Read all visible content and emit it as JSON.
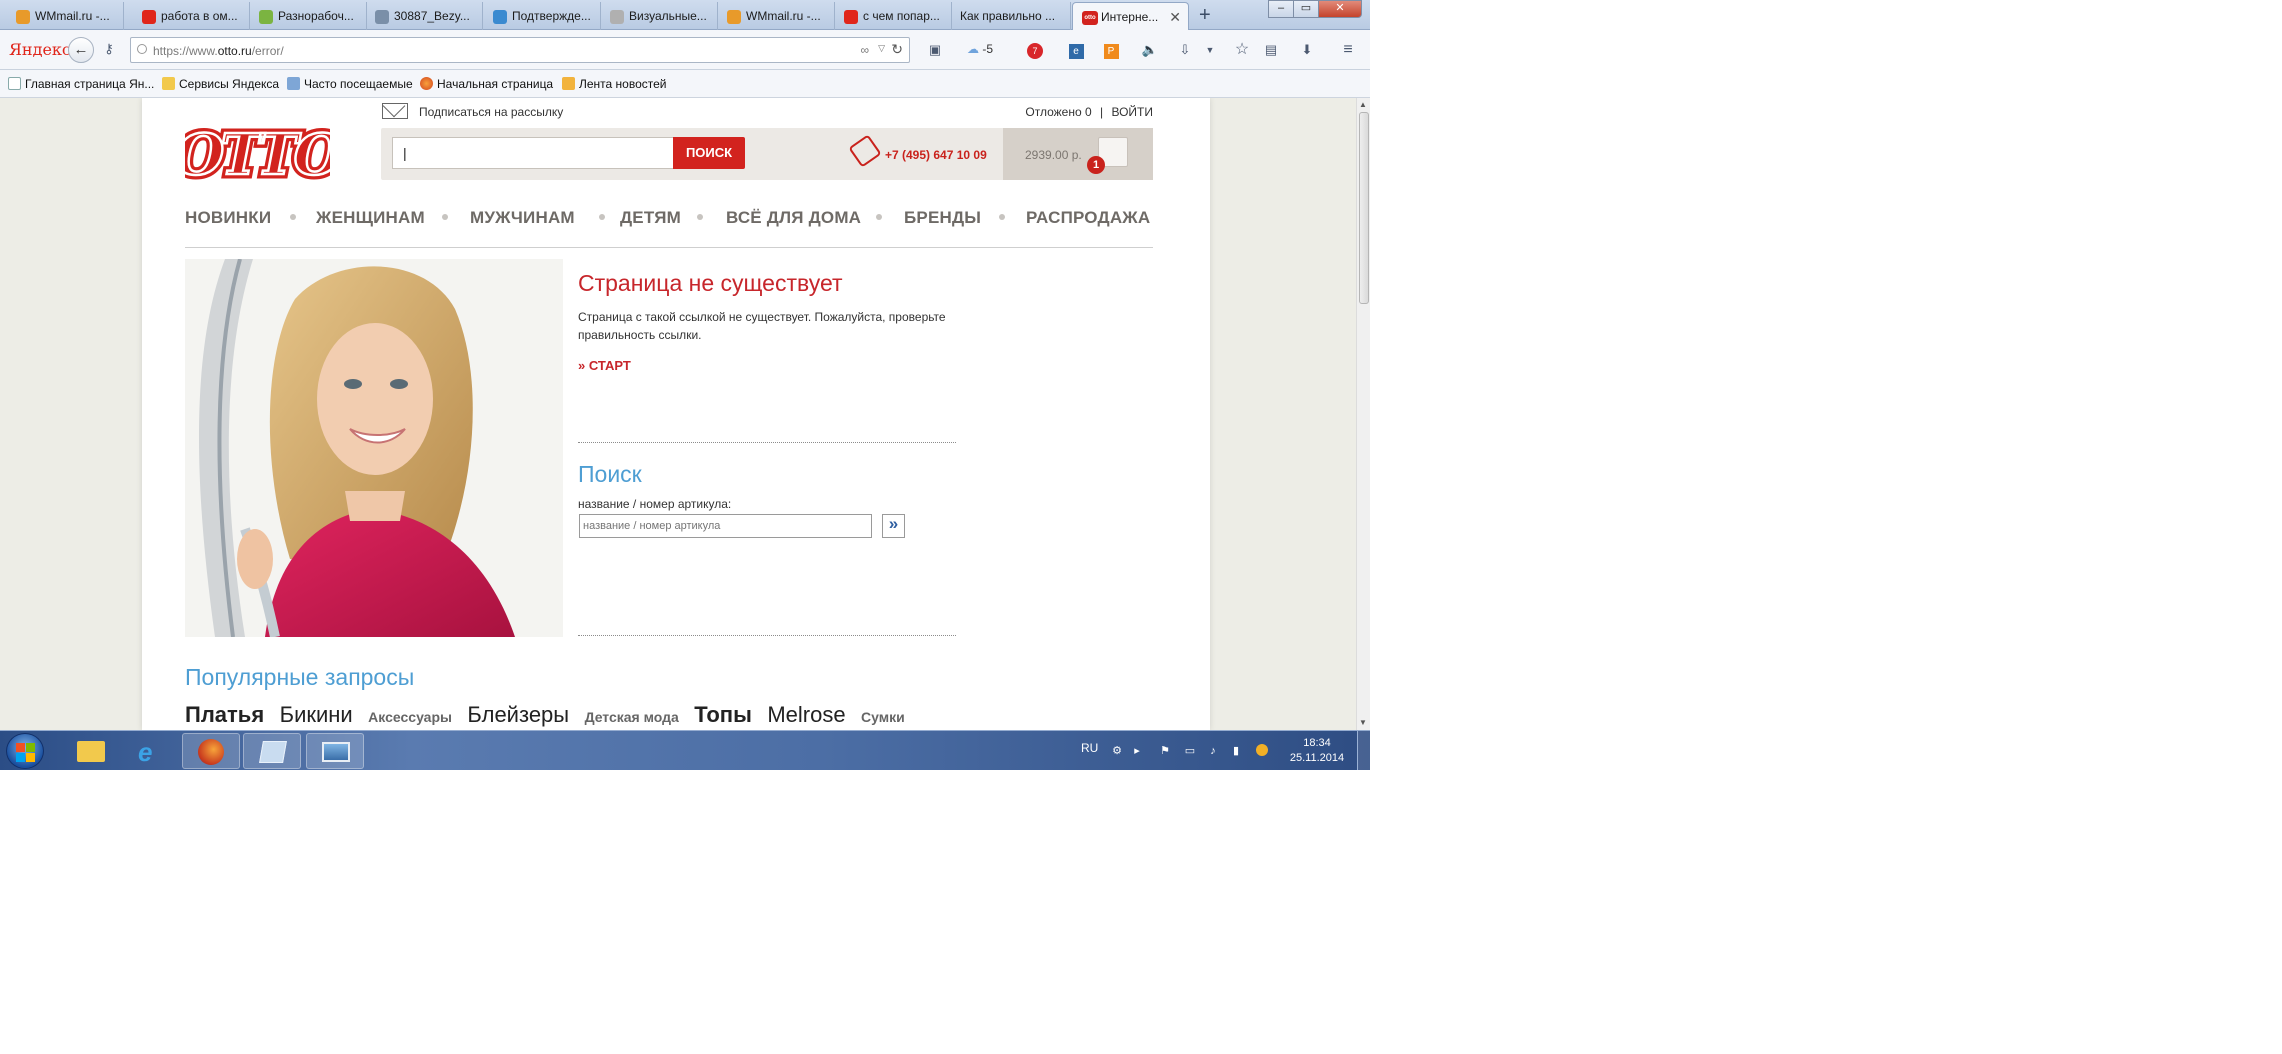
{
  "browser": {
    "tabs": [
      {
        "label": "WMmail.ru -...",
        "icon": "wmmail-icon",
        "color": "#e89a2a"
      },
      {
        "label": "работа в ом...",
        "icon": "yandex-icon",
        "color": "#e0261b"
      },
      {
        "label": "Разнорабоч...",
        "icon": "green-icon",
        "color": "#7bb441"
      },
      {
        "label": "30887_Bezy...",
        "icon": "image-icon",
        "color": "#7a8fa8"
      },
      {
        "label": "Подтвержде...",
        "icon": "globe-icon",
        "color": "#3a8ad0"
      },
      {
        "label": "Визуальные...",
        "icon": "page-icon",
        "color": "#b0b0b0"
      },
      {
        "label": "WMmail.ru -...",
        "icon": "wmmail-icon",
        "color": "#e89a2a"
      },
      {
        "label": "с чем попар...",
        "icon": "yandex-icon",
        "color": "#e0261b"
      },
      {
        "label": "Как правильно ...",
        "icon": "",
        "color": ""
      },
      {
        "label": "Интерне...",
        "icon": "otto-icon",
        "color": "#d2231e",
        "icon_text": "otto"
      }
    ],
    "new_tab_glyph": "+",
    "close_glyph": "✕",
    "yandex_label": "Яндекс",
    "url_prefix": "https://www.",
    "url_domain": "otto.ru",
    "url_path": "/error/",
    "weather": "-5",
    "mail_badge": "7",
    "bookmarks": [
      {
        "label": "Главная страница Ян...",
        "icon": "page-icon"
      },
      {
        "label": "Сервисы Яндекса",
        "icon": "folder-icon"
      },
      {
        "label": "Часто посещаемые",
        "icon": "star-folder-icon"
      },
      {
        "label": "Начальная страница",
        "icon": "firefox-icon"
      },
      {
        "label": "Лента новостей",
        "icon": "rss-icon"
      }
    ]
  },
  "site": {
    "newsletter": "Подписаться на рассылку",
    "deferred": "Отложено 0",
    "separator": "|",
    "login": "ВОЙТИ",
    "logo_text": "OTTO",
    "search_value": "|",
    "search_button": "ПОИСК",
    "phone": "+7 (495) 647 10 09",
    "cart_total": "2939.00 р.",
    "cart_count": "1",
    "nav": [
      "НОВИНКИ",
      "ЖЕНЩИНАМ",
      "МУЖЧИНАМ",
      "ДЕТЯМ",
      "ВСЁ ДЛЯ ДОМА",
      "БРЕНДЫ",
      "РАСПРОДАЖА"
    ],
    "error_title": "Страница не существует",
    "error_text": "Страница с такой ссылкой не существует. Пожалуйста, проверьте правильность ссылки.",
    "start_link": "» СТАРТ",
    "search_title": "Поиск",
    "search_label": "название / номер артикула:",
    "search_placeholder": "название / номер артикула",
    "search_go": "»",
    "popular_title": "Популярные запросы",
    "popular_tags": [
      {
        "label": "Платья",
        "weight": "bold",
        "size": "large"
      },
      {
        "label": "Бикини",
        "weight": "normal",
        "size": "large"
      },
      {
        "label": "Аксессуары",
        "weight": "bold",
        "size": "small"
      },
      {
        "label": "Блейзеры",
        "weight": "normal",
        "size": "large"
      },
      {
        "label": "Детская мода",
        "weight": "bold",
        "size": "small"
      },
      {
        "label": "Топы",
        "weight": "bold",
        "size": "large"
      },
      {
        "label": "Melrose",
        "weight": "normal",
        "size": "large"
      },
      {
        "label": "Сумки",
        "weight": "bold",
        "size": "small"
      }
    ]
  },
  "taskbar": {
    "lang": "RU",
    "time": "18:34",
    "date": "25.11.2014"
  }
}
